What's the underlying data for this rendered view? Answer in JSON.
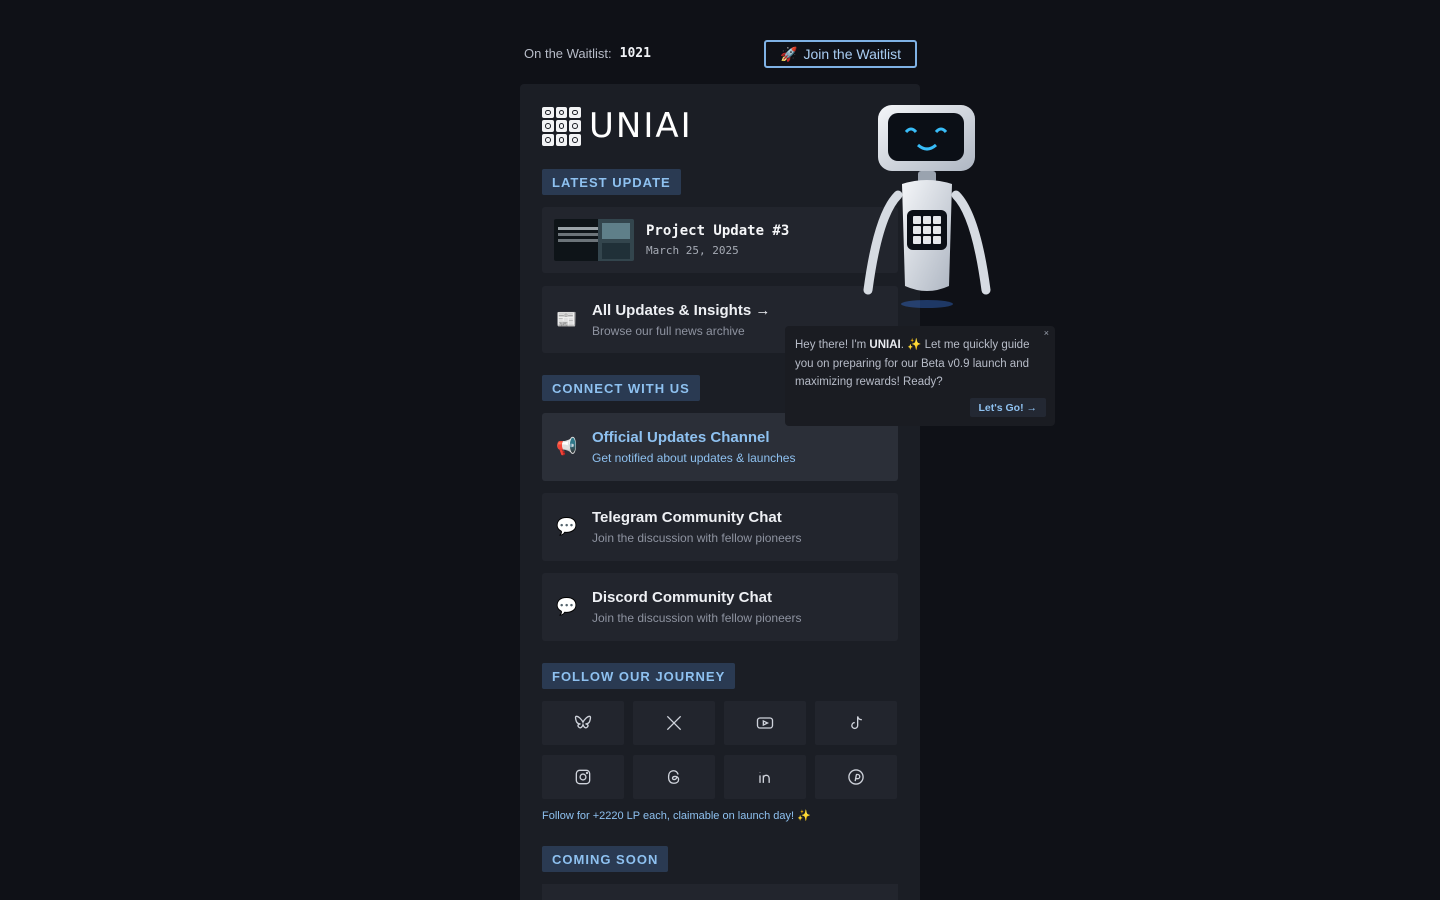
{
  "topbar": {
    "waitlist_label": "On the Waitlist:",
    "waitlist_count": "1021",
    "join_icon": "🚀",
    "join_label": "Join the Waitlist"
  },
  "brand": {
    "name": "UNIAI"
  },
  "sections": {
    "latest_update": "LATEST UPDATE",
    "connect": "CONNECT WITH US",
    "follow": "FOLLOW OUR JOURNEY",
    "coming_soon": "COMING SOON"
  },
  "latest_update": {
    "title": "Project Update #3",
    "date": "March 25, 2025"
  },
  "all_updates": {
    "icon": "📰",
    "title": "All Updates & Insights →",
    "subtitle": "Browse our full news archive"
  },
  "connect": [
    {
      "icon": "📢",
      "title": "Official Updates Channel",
      "subtitle": "Get notified about updates & launches"
    },
    {
      "icon": "💬",
      "title": "Telegram Community Chat",
      "subtitle": "Join the discussion with fellow pioneers"
    },
    {
      "icon": "💬",
      "title": "Discord Community Chat",
      "subtitle": "Join the discussion with fellow pioneers"
    }
  ],
  "socials": [
    "bluesky-icon",
    "x-icon",
    "youtube-icon",
    "tiktok-icon",
    "instagram-icon",
    "threads-icon",
    "linkedin-icon",
    "pinterest-icon"
  ],
  "follow_note": "Follow for +2220 LP each, claimable on launch day! ✨",
  "assistant": {
    "greeting_prefix": "Hey there! I'm ",
    "greeting_name": "UNIAI",
    "greeting_suffix": ". ✨ Let me quickly guide you on preparing for our Beta v0.9 launch and maximizing rewards! Ready?",
    "cta": "Let's Go! →",
    "close": "×"
  },
  "colors": {
    "accent": "#8ec1f0",
    "background": "#0f1117",
    "panel": "#1b1e25"
  }
}
